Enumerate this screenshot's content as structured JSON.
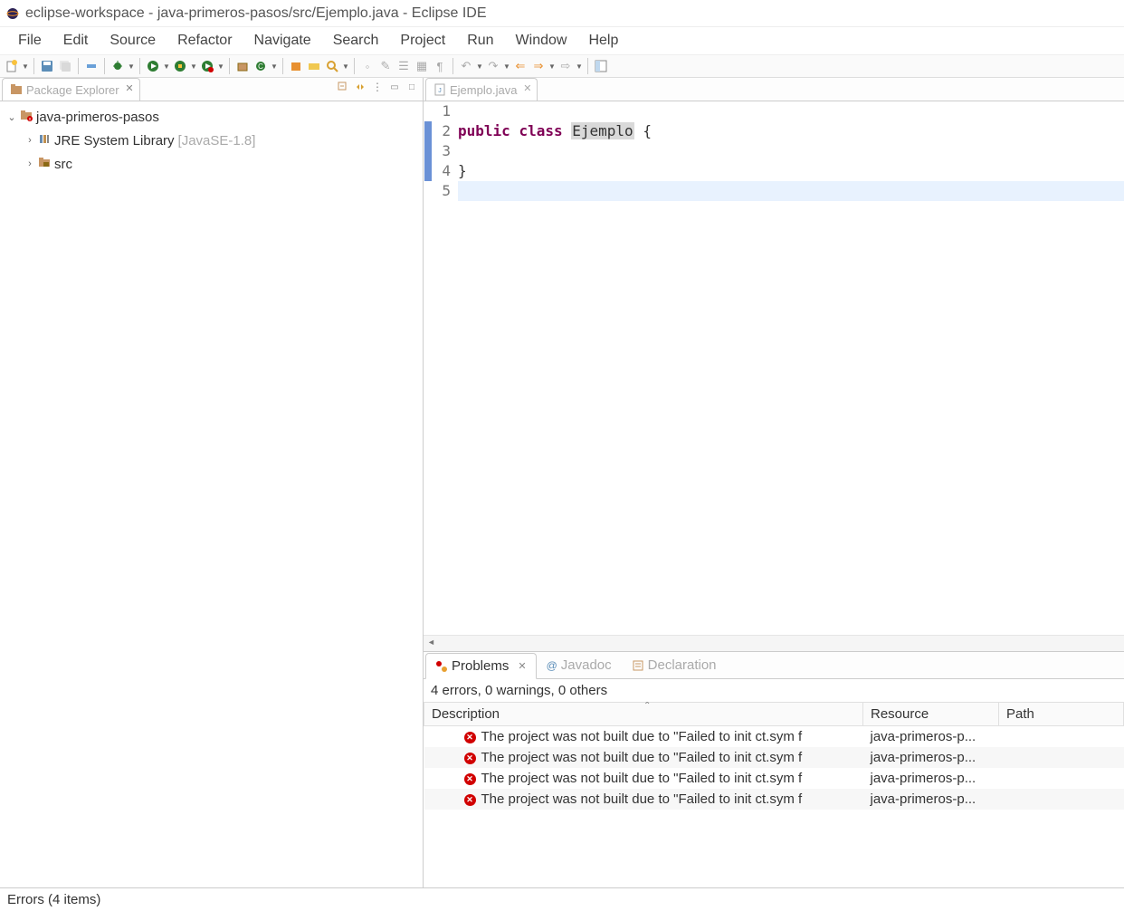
{
  "title": "eclipse-workspace - java-primeros-pasos/src/Ejemplo.java - Eclipse IDE",
  "menu": [
    "File",
    "Edit",
    "Source",
    "Refactor",
    "Navigate",
    "Search",
    "Project",
    "Run",
    "Window",
    "Help"
  ],
  "package_explorer": {
    "tab_label": "Package Explorer",
    "project": "java-primeros-pasos",
    "jre": "JRE System Library",
    "jre_suffix": "[JavaSE-1.8]",
    "src": "src"
  },
  "editor": {
    "tab_label": "Ejemplo.java",
    "lines": [
      "",
      "public class Ejemplo {",
      "",
      "}",
      ""
    ],
    "line_numbers": [
      "1",
      "2",
      "3",
      "4",
      "5"
    ]
  },
  "problems": {
    "tab_label": "Problems",
    "javadoc_label": "Javadoc",
    "declaration_label": "Declaration",
    "summary": "4 errors, 0 warnings, 0 others",
    "columns": [
      "Description",
      "Resource",
      "Path"
    ],
    "rows": [
      {
        "desc": "The project was not built due to \"Failed to init ct.sym f",
        "res": "java-primeros-p..."
      },
      {
        "desc": "The project was not built due to \"Failed to init ct.sym f",
        "res": "java-primeros-p..."
      },
      {
        "desc": "The project was not built due to \"Failed to init ct.sym f",
        "res": "java-primeros-p..."
      },
      {
        "desc": "The project was not built due to \"Failed to init ct.sym f",
        "res": "java-primeros-p..."
      }
    ]
  },
  "status": "Errors (4 items)"
}
